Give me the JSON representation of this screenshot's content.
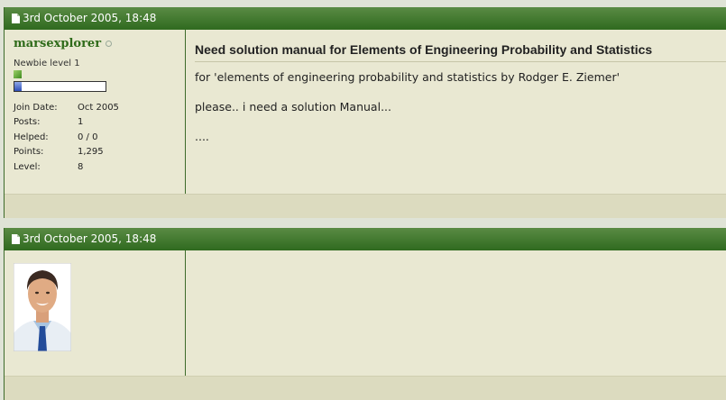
{
  "post1": {
    "date": "3rd October 2005, 18:48",
    "user": {
      "name": "marsexplorer",
      "title": "Newbie level 1",
      "progress": 0.08,
      "stats": [
        {
          "label": "Join Date:",
          "value": "Oct 2005"
        },
        {
          "label": "Posts:",
          "value": "1"
        },
        {
          "label": "Helped:",
          "value": "0 / 0"
        },
        {
          "label": "Points:",
          "value": "1,295"
        },
        {
          "label": "Level:",
          "value": "8"
        }
      ]
    },
    "title": "Need solution manual for Elements of Engineering Probability and Statistics",
    "lines": [
      "for 'elements of engineering probability and statistics by Rodger E. Ziemer'",
      "please.. i need a solution Manual...",
      "...."
    ]
  },
  "post2": {
    "date": "3rd October 2005, 18:48"
  },
  "colors": {
    "header_green": "#2f6a1f",
    "username_green": "#2f6b1a",
    "post_bg": "#e9e8d2"
  }
}
